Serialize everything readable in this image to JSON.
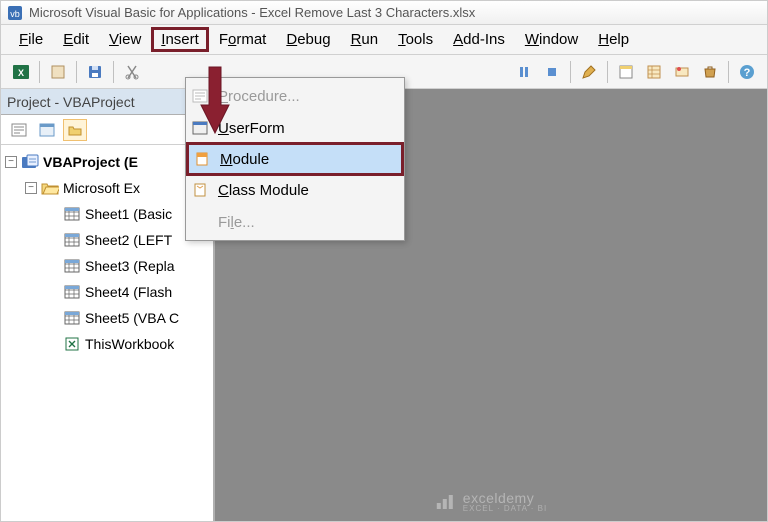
{
  "title": "Microsoft Visual Basic for Applications - Excel Remove Last 3 Characters.xlsx",
  "menu": {
    "file": "File",
    "edit": "Edit",
    "view": "View",
    "insert": "Insert",
    "format": "Format",
    "debug": "Debug",
    "run": "Run",
    "tools": "Tools",
    "addins": "Add-Ins",
    "window": "Window",
    "help": "Help"
  },
  "insert_menu": {
    "procedure": "Procedure...",
    "userform": "UserForm",
    "module": "Module",
    "class_module": "Class Module",
    "file": "File..."
  },
  "project_pane": {
    "title": "Project - VBAProject",
    "root": "VBAProject (E",
    "folder": "Microsoft Ex",
    "items": [
      "Sheet1 (Basic",
      "Sheet2 (LEFT",
      "Sheet3 (Repla",
      "Sheet4 (Flash",
      "Sheet5 (VBA C",
      "ThisWorkbook"
    ]
  },
  "watermark": {
    "main": "exceldemy",
    "sub": "EXCEL · DATA · BI"
  }
}
